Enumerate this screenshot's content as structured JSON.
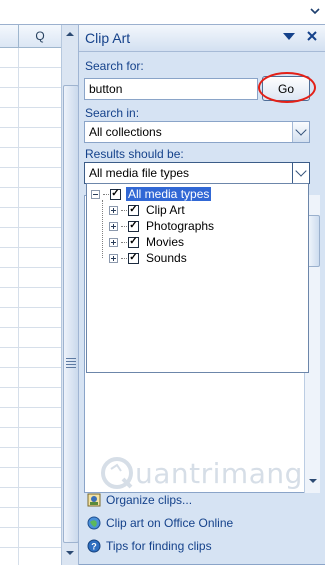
{
  "sheet": {
    "column_header_label": "Q"
  },
  "pane": {
    "title": "Clip Art",
    "search": {
      "label": "Search for:",
      "value": "button",
      "go_label": "Go"
    },
    "search_in": {
      "label": "Search in:",
      "value": "All collections"
    },
    "results_type": {
      "label": "Results should be:",
      "value": "All media file types",
      "tree": [
        {
          "label": "All media types",
          "checked": true,
          "selected": true
        },
        {
          "label": "Clip Art",
          "checked": true
        },
        {
          "label": "Photographs",
          "checked": true
        },
        {
          "label": "Movies",
          "checked": true
        },
        {
          "label": "Sounds",
          "checked": true
        }
      ]
    },
    "watermark": {
      "text": "uantrimang"
    },
    "links": [
      {
        "label": "Organize clips...",
        "icon": "organize-clips-icon"
      },
      {
        "label": "Clip art on Office Online",
        "icon": "office-online-icon"
      },
      {
        "label": "Tips for finding clips",
        "icon": "help-icon"
      }
    ]
  },
  "colors": {
    "pane_background": "#d6e3f3",
    "title_text": "#15428b",
    "selection": "#3168d5",
    "highlight_circle": "#e32017"
  }
}
